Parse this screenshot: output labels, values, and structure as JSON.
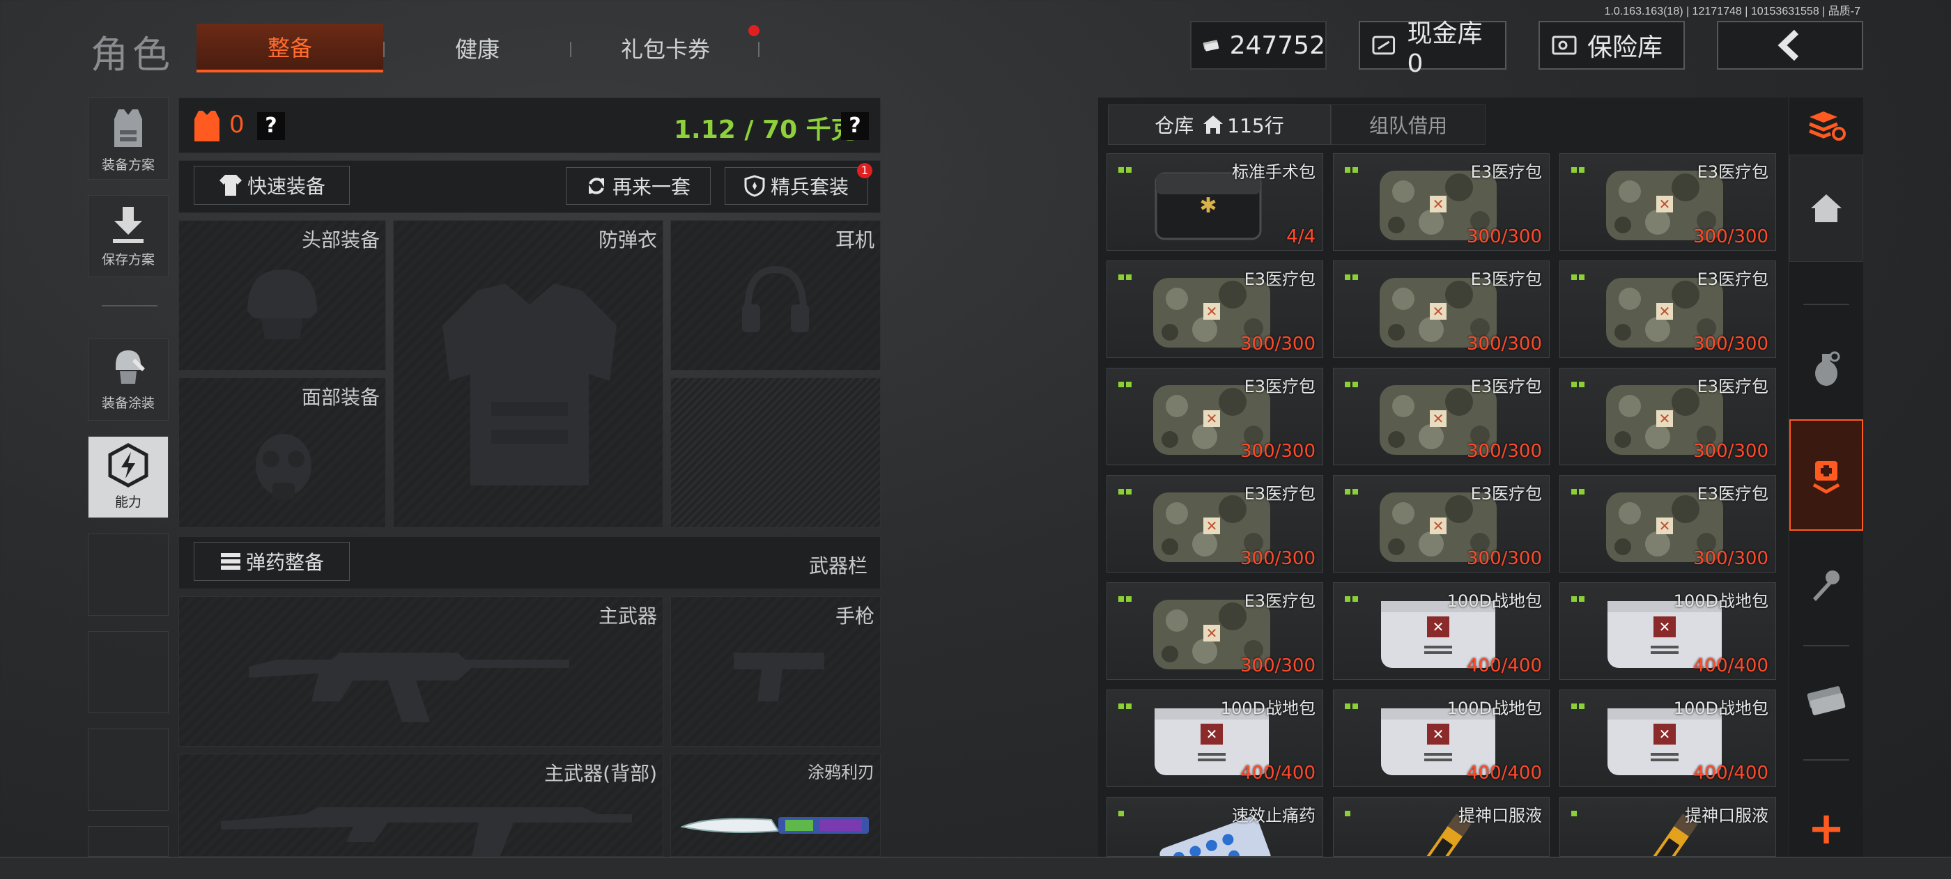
{
  "version": "1.0.163.163(18) | 12171748 | 10153631558 | 品质-7",
  "nav": {
    "title": "角色",
    "tabs": [
      {
        "label": "整备",
        "active": true
      },
      {
        "label": "健康",
        "active": false
      },
      {
        "label": "礼包卡券",
        "active": false,
        "badge_dot": true
      }
    ]
  },
  "currency": {
    "amount": "247752"
  },
  "top_buttons": {
    "cash_vault": "现金库 0",
    "safe_vault": "保险库"
  },
  "sidebar": {
    "items": [
      {
        "label": "装备方案"
      },
      {
        "label": "保存方案"
      },
      {
        "label": "装备涂装"
      },
      {
        "label": "能力"
      }
    ]
  },
  "equip": {
    "armor_value": "0",
    "help": "?",
    "weight": "1.12 / 70 千克",
    "quick_equip": "快速装备",
    "again": "再来一套",
    "elite": "精兵套装",
    "elite_badge": "1",
    "slots": {
      "head": "头部装备",
      "armor": "防弹衣",
      "headset": "耳机",
      "face": "面部装备"
    },
    "ammo_btn": "弹药整备",
    "weapon_bar": "武器栏",
    "weapon_slots": {
      "primary": "主武器",
      "pistol": "手枪",
      "primary_back": "主武器(背部)",
      "melee": "涂鸦利刃"
    }
  },
  "warehouse": {
    "tab_main": "仓库",
    "tab_rows": "115行",
    "tab_team": "组队借用",
    "items": [
      {
        "name": "标准手术包",
        "count": "4/4",
        "kind": "surgery"
      },
      {
        "name": "E3医疗包",
        "count": "300/300",
        "kind": "camo"
      },
      {
        "name": "E3医疗包",
        "count": "300/300",
        "kind": "camo"
      },
      {
        "name": "E3医疗包",
        "count": "300/300",
        "kind": "camo"
      },
      {
        "name": "E3医疗包",
        "count": "300/300",
        "kind": "camo"
      },
      {
        "name": "E3医疗包",
        "count": "300/300",
        "kind": "camo"
      },
      {
        "name": "E3医疗包",
        "count": "300/300",
        "kind": "camo"
      },
      {
        "name": "E3医疗包",
        "count": "300/300",
        "kind": "camo"
      },
      {
        "name": "E3医疗包",
        "count": "300/300",
        "kind": "camo"
      },
      {
        "name": "E3医疗包",
        "count": "300/300",
        "kind": "camo"
      },
      {
        "name": "E3医疗包",
        "count": "300/300",
        "kind": "camo"
      },
      {
        "name": "E3医疗包",
        "count": "300/300",
        "kind": "camo"
      },
      {
        "name": "E3医疗包",
        "count": "300/300",
        "kind": "camo"
      },
      {
        "name": "100D战地包",
        "count": "400/400",
        "kind": "white"
      },
      {
        "name": "100D战地包",
        "count": "400/400",
        "kind": "white"
      },
      {
        "name": "100D战地包",
        "count": "400/400",
        "kind": "white"
      },
      {
        "name": "100D战地包",
        "count": "400/400",
        "kind": "white"
      },
      {
        "name": "100D战地包",
        "count": "400/400",
        "kind": "white"
      },
      {
        "name": "速效止痛药",
        "count": "",
        "kind": "pills"
      },
      {
        "name": "提神口服液",
        "count": "",
        "kind": "vial"
      },
      {
        "name": "提神口服液",
        "count": "",
        "kind": "vial"
      }
    ]
  },
  "right_column": {
    "add": "+"
  },
  "colors": {
    "accent": "#ff5a1f",
    "count_red": "#ff4a2a",
    "weight_green": "#8fd13a",
    "green_dot": "#8bd136"
  }
}
